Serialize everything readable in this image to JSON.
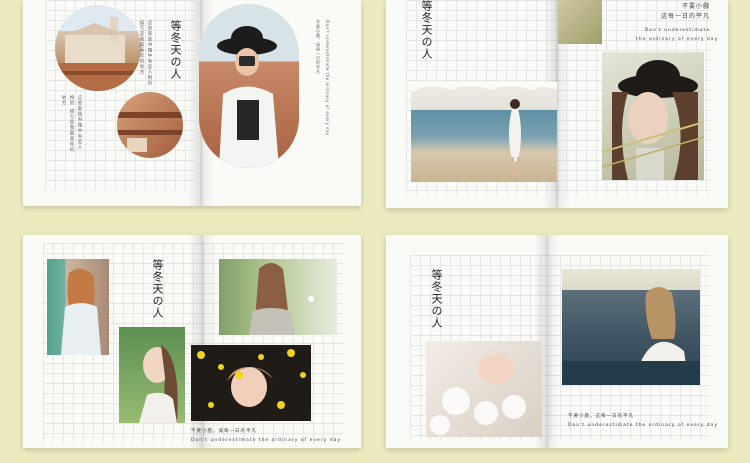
{
  "title": "等冬天の人",
  "subtitle_cn": "不要小戲，诚每一日的平凡",
  "subtitle_en": "Don't underestimate the ordinary of every day",
  "spreads": [
    {
      "title": "等冬天の人",
      "caption_cn": "不要小戲，诚每一日的平凡",
      "caption_en": "Don't underestimate the ordinary of every day",
      "body": "这些家族书籍中有些人物的\n描写是我最喜欢的地方\n"
    },
    {
      "title": "等冬天の人",
      "caption_cn": "不要小戲\n这每一日的平凡",
      "caption_en": "Don't underestimate\nthe ordinary of every day",
      "body": ""
    },
    {
      "title": "等冬天の人",
      "caption_cn": "不要小戲，诚每一日的平凡",
      "caption_en": "Don't underestimate the ordinary of every day",
      "body": ""
    },
    {
      "title": "等冬天の人",
      "caption_cn": "不要小戲，这每一日的平凡",
      "caption_en": "Don't underestimate the ordinary of every day",
      "body": ""
    }
  ]
}
